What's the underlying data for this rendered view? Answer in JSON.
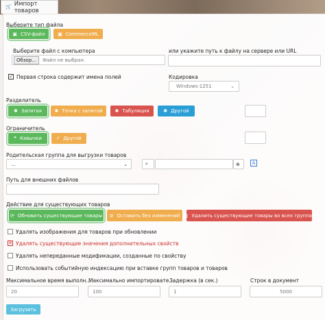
{
  "tab": {
    "title": "Импорт товаров",
    "icon": "cart-icon"
  },
  "file_type": {
    "label": "Выберите тип файла",
    "options": [
      {
        "label": "CSV-файл",
        "icon": "file-icon",
        "color": "#5cb85c",
        "active": true
      },
      {
        "label": "CommerceML",
        "icon": "file-icon",
        "color": "#f0ad4e",
        "active": false
      }
    ]
  },
  "file_from_computer": {
    "label": "Выберите файл с компьютера",
    "browse_button": "Обзор...",
    "status": "Файл не выбран."
  },
  "server_path": {
    "label": "или укажите путь к файлу на сервере или URL",
    "value": ""
  },
  "first_row_names": {
    "label": "Первая строка содержит имена полей",
    "checked": true
  },
  "encoding": {
    "label": "Кодировка",
    "value": "Windows-1251"
  },
  "delimiter": {
    "label": "Разделитель",
    "options": [
      {
        "label": "Запятая",
        "icon": "asterisk-icon",
        "color": "#5cb85c",
        "active": true
      },
      {
        "label": "Точка с запятой",
        "icon": "asterisk-icon",
        "color": "#f0ad4e",
        "active": false
      },
      {
        "label": "Табуляция",
        "icon": "asterisk-icon",
        "color": "#d9534f",
        "active": false
      },
      {
        "label": "Другой",
        "icon": "asterisk-icon",
        "color": "#2a9fd6",
        "active": false
      }
    ],
    "custom_value": ""
  },
  "enclosure": {
    "label": "Ограничитель",
    "options": [
      {
        "label": "Кавычки",
        "icon": "quote-icon",
        "color": "#5cb85c",
        "active": true
      },
      {
        "label": "Другой",
        "icon": "bolt-icon",
        "color": "#f0ad4e",
        "active": false
      }
    ],
    "custom_value": ""
  },
  "parent_group": {
    "label": "Родительская группа для выгрузки товаров",
    "value": "...",
    "search_value": ""
  },
  "external_files_path": {
    "label": "Путь для внешних файлов",
    "value": ""
  },
  "existing_action": {
    "label": "Действие для существующих товаров",
    "options": [
      {
        "label": "Обновить существующие товары",
        "icon": "refresh-icon",
        "color": "#5cb85c",
        "active": true
      },
      {
        "label": "Оставить без изменений",
        "icon": "ban-icon",
        "color": "#f0ad4e",
        "active": false
      },
      {
        "label": "Удалить существующие товары во всех группах",
        "icon": "trash-icon",
        "color": "#d9534f",
        "active": false
      }
    ]
  },
  "checkboxes": [
    {
      "label": "Удалять изображения для товаров при обновлении",
      "checked": false,
      "warning": false
    },
    {
      "label": "Удалять существующие значения дополнительных свойств",
      "checked": true,
      "warning": true
    },
    {
      "label": "Удалять непереданные модификации, созданные по свойству",
      "checked": false,
      "warning": false
    },
    {
      "label": "Использовать событийную индексацию при вставке групп товаров и товаров",
      "checked": false,
      "warning": false
    }
  ],
  "numbers": [
    {
      "label": "Максимальное время выполн...",
      "value": "20"
    },
    {
      "label": "Максимально импортировате...",
      "value": "100"
    },
    {
      "label": "Задержка (в сек.)",
      "value": "1"
    },
    {
      "label": "Строк в документ",
      "value": "5000"
    }
  ],
  "submit": {
    "label": "Загрузить",
    "color": "#5bc0de"
  }
}
